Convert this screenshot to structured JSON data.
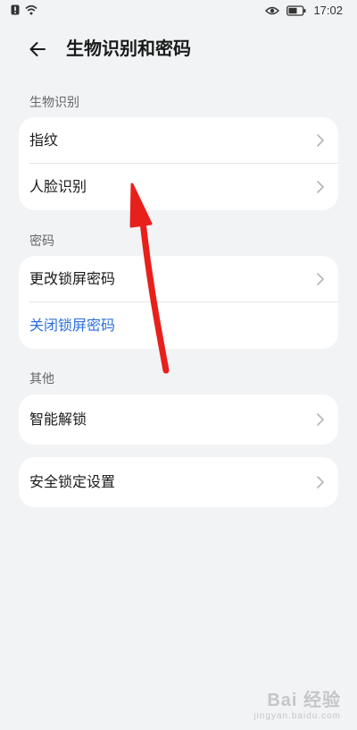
{
  "status_bar": {
    "time": "17:02"
  },
  "header": {
    "title": "生物识别和密码"
  },
  "sections": {
    "biometrics": {
      "label": "生物识别",
      "items": [
        {
          "label": "指纹"
        },
        {
          "label": "人脸识别"
        }
      ]
    },
    "password": {
      "label": "密码",
      "items": [
        {
          "label": "更改锁屏密码"
        },
        {
          "label": "关闭锁屏密码"
        }
      ]
    },
    "other": {
      "label": "其他",
      "items": [
        {
          "label": "智能解锁"
        }
      ]
    },
    "security_lock": {
      "items": [
        {
          "label": "安全锁定设置"
        }
      ]
    }
  },
  "annotation": {
    "arrow_color": "#e8201c"
  },
  "watermark": {
    "main": "Bai 经验",
    "sub": "jingyan.baidu.com"
  },
  "colors": {
    "background": "#f1f3f5",
    "card": "#ffffff",
    "link_blue": "#2a6fdb"
  }
}
